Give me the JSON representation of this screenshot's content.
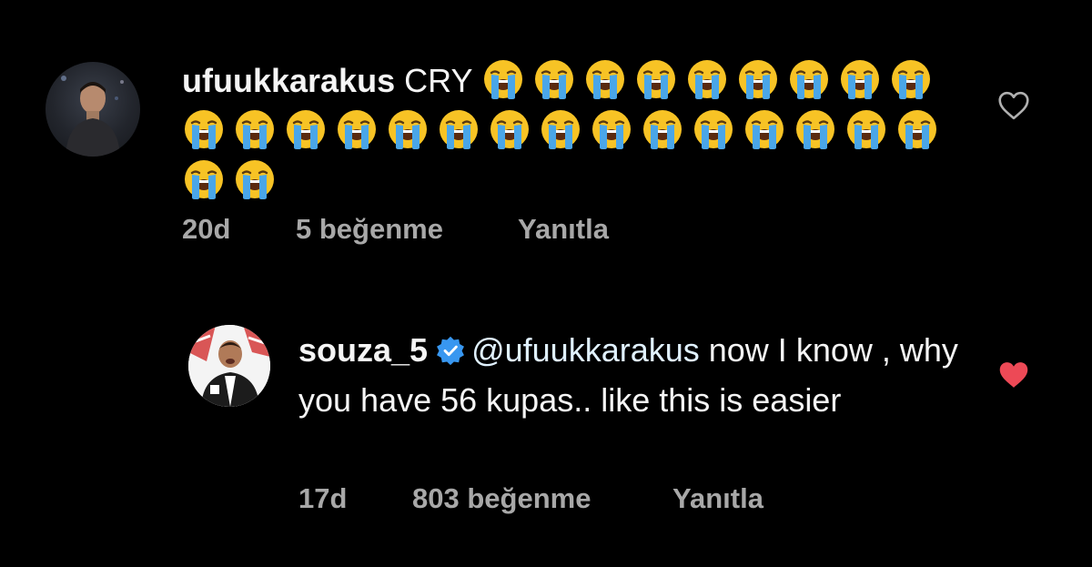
{
  "comments": [
    {
      "username": "ufuukkarakus",
      "text": "CRY",
      "emoji_name": "loudly-crying-face",
      "emoji_count": 26,
      "time": "20d",
      "likes": "5 beğenme",
      "reply_label": "Yanıtla",
      "liked": false
    },
    {
      "username": "souza_5",
      "verified": true,
      "mention": "@ufuukkarakus",
      "text": "now I know , why you have 56 kupas.. like this is easier",
      "time": "17d",
      "likes": "803 beğenme",
      "reply_label": "Yanıtla",
      "liked": true
    }
  ],
  "colors": {
    "background": "#000000",
    "text": "#f5f5f5",
    "meta": "#a8a8a8",
    "liked_heart": "#ed4956",
    "verified": "#3897f0"
  }
}
